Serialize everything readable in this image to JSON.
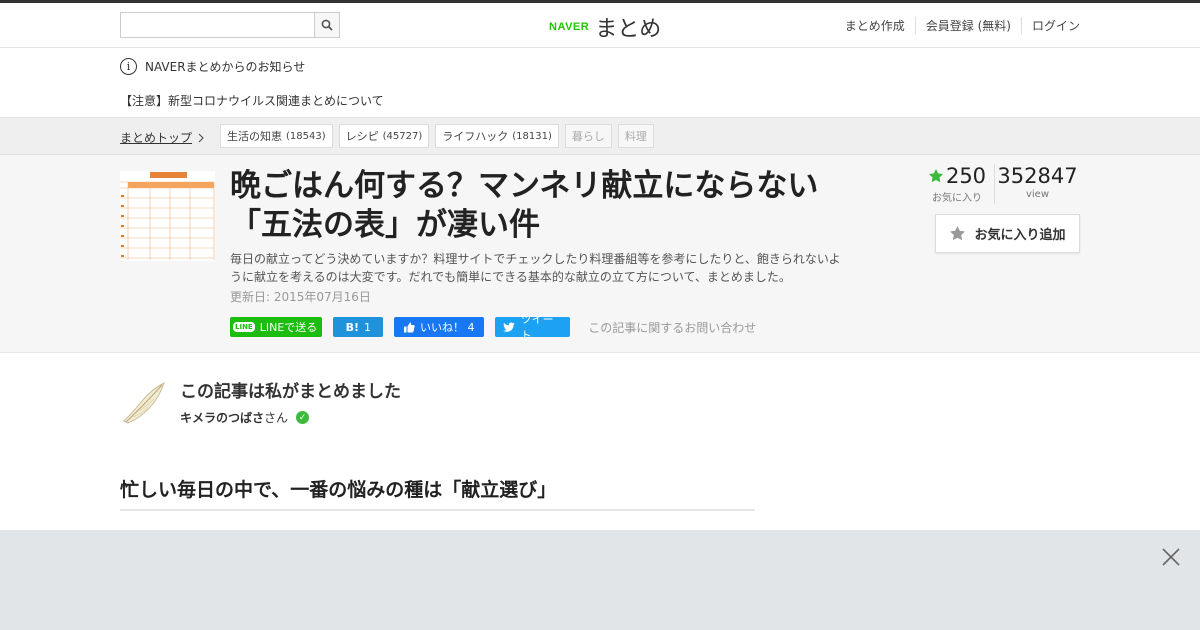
{
  "header": {
    "search": {
      "value": "",
      "placeholder": ""
    },
    "logo": {
      "brand": "NAVER",
      "name": "まとめ"
    },
    "nav": [
      "まとめ作成",
      "会員登録 (無料)",
      "ログイン"
    ]
  },
  "notice": {
    "title": "NAVERまとめからのお知らせ",
    "item": "【注意】新型コロナウイルス関連まとめについて"
  },
  "breadcrumb": {
    "home": "まとめトップ",
    "tags": [
      {
        "label": "生活の知恵",
        "count": "(18543)"
      },
      {
        "label": "レシピ",
        "count": "(45727)"
      },
      {
        "label": "ライフハック",
        "count": "(18131)"
      },
      {
        "label": "暮らし",
        "count": ""
      },
      {
        "label": "料理",
        "count": ""
      }
    ]
  },
  "article": {
    "title": "晩ごはん何する？マンネリ献立にならない「五法の表」が凄い件",
    "description": "毎日の献立ってどう決めていますか？料理サイトでチェックしたり料理番組等を参考にしたりと、飽きられないように献立を考えるのは大変です。だれでも簡単にできる基本的な献立の立て方について、まとめました。",
    "updated": "更新日: 2015年07月16日",
    "share": {
      "line": "LINEで送る",
      "line_icon": "LINE",
      "hatena": "1",
      "hatena_icon": "B!",
      "facebook": "いいね！ 4",
      "twitter": "ツイート"
    },
    "inquiry": "この記事に関するお問い合わせ",
    "favorites": {
      "count": "250",
      "label": "お気に入り"
    },
    "views": {
      "count": "352847",
      "label": "view"
    },
    "fav_button": "お気に入り追加"
  },
  "author": {
    "byline": "この記事は私がまとめました",
    "name": "キメラのつばさ",
    "suffix": "さん"
  },
  "section": {
    "heading": "忙しい毎日の中で、一番の悩みの種は「献立選び」"
  },
  "colors": {
    "naver_green": "#1ec800",
    "line_green": "#1dbd0f",
    "hatena_blue": "#1e93dc",
    "facebook_blue": "#1877f2",
    "twitter_blue": "#1da1f2",
    "star_green": "#3db93d"
  },
  "icons": [
    "search-icon",
    "info-icon",
    "chevron-right-icon",
    "star-icon",
    "twitter-bird-icon",
    "thumbs-up-icon",
    "check-icon",
    "close-icon"
  ]
}
